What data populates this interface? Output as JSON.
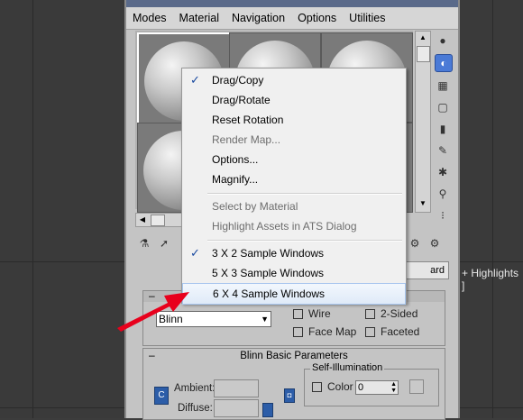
{
  "viewport": {
    "label": "+ Highlights ]"
  },
  "menubar": {
    "items": [
      "Modes",
      "Material",
      "Navigation",
      "Options",
      "Utilities"
    ]
  },
  "slot_panel": {
    "name_field": "ard"
  },
  "context_menu": {
    "items": [
      {
        "label": "Drag/Copy",
        "checked": true,
        "disabled": false
      },
      {
        "label": "Drag/Rotate",
        "checked": false,
        "disabled": false
      },
      {
        "label": "Reset Rotation",
        "checked": false,
        "disabled": false
      },
      {
        "label": "Render Map...",
        "checked": false,
        "disabled": true
      },
      {
        "label": "Options...",
        "checked": false,
        "disabled": false
      },
      {
        "label": "Magnify...",
        "checked": false,
        "disabled": false
      },
      {
        "label": "Select by Material",
        "checked": false,
        "disabled": true
      },
      {
        "label": "Highlight Assets in ATS Dialog",
        "checked": false,
        "disabled": true
      },
      {
        "label": "3 X 2 Sample Windows",
        "checked": true,
        "disabled": false
      },
      {
        "label": "5 X 3 Sample Windows",
        "checked": false,
        "disabled": false
      },
      {
        "label": "6 X 4 Sample Windows",
        "checked": false,
        "disabled": false,
        "highlighted": true
      }
    ],
    "check_glyph": "✓"
  },
  "shader_basic": {
    "shader": "Blinn",
    "wire": "Wire",
    "two_sided": "2-Sided",
    "face_map": "Face Map",
    "faceted": "Faceted"
  },
  "blinn_basic": {
    "title": "Blinn Basic Parameters",
    "ambient_label": "Ambient:",
    "diffuse_label": "Diffuse:",
    "self_illum_title": "Self-Illumination",
    "color_label": "Color",
    "color_value": "0"
  },
  "colors": {
    "accent": "#4a7ad6",
    "arrow": "#e8001c"
  }
}
